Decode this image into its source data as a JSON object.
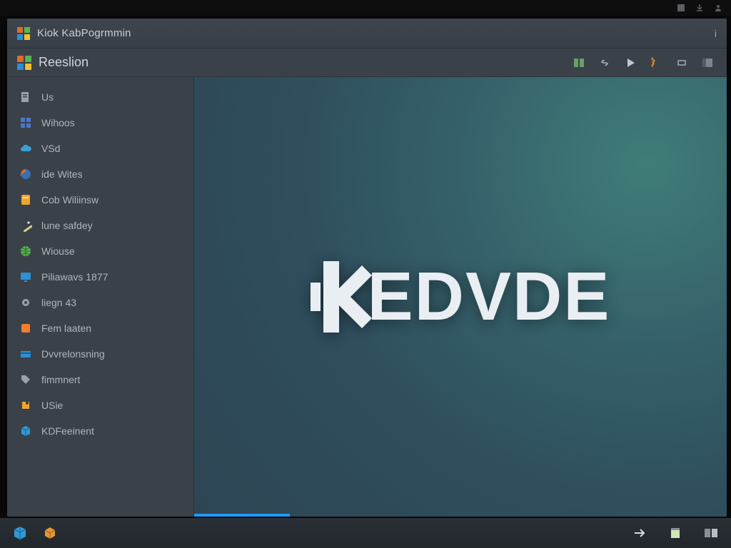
{
  "window": {
    "title": "Kiok KabPogrmmin",
    "title_right": "i",
    "section": "Reeslion"
  },
  "sidebar": {
    "items": [
      {
        "label": "Us",
        "icon": "document-icon",
        "tint": "#9aa1a7"
      },
      {
        "label": "Wihoos",
        "icon": "grid-icon",
        "tint": "#4a78c9"
      },
      {
        "label": "VSd",
        "icon": "cloud-icon",
        "tint": "#3aa0d8"
      },
      {
        "label": "ide Wites",
        "icon": "fox-icon",
        "tint": "#e06b2c"
      },
      {
        "label": "Cob Wiliinsw",
        "icon": "note-icon",
        "tint": "#f0a52e"
      },
      {
        "label": "lune safdey",
        "icon": "wand-icon",
        "tint": "#d9ce8a"
      },
      {
        "label": "Wiouse",
        "icon": "globe-icon",
        "tint": "#59b553"
      },
      {
        "label": "Piliawavs 1877",
        "icon": "monitor-icon",
        "tint": "#2e8fd6"
      },
      {
        "label": "liegn 43",
        "icon": "gear-icon",
        "tint": "#9aa1a7"
      },
      {
        "label": "Fem laaten",
        "icon": "square-icon",
        "tint": "#f07e2e"
      },
      {
        "label": "Dvvrelonsning",
        "icon": "card-icon",
        "tint": "#2e8fd6"
      },
      {
        "label": "fimmnert",
        "icon": "tag-icon",
        "tint": "#9aa1a7"
      },
      {
        "label": "USie",
        "icon": "puzzle-icon",
        "tint": "#f0a52e"
      },
      {
        "label": "KDFeeinent",
        "icon": "cube-icon",
        "tint": "#2e9bd6"
      }
    ]
  },
  "content": {
    "brand_text": "EDVDE"
  },
  "toolbar_icons": [
    "book-icon",
    "link-icon",
    "play-icon",
    "script-icon",
    "chip-icon",
    "panel-icon"
  ],
  "sys_icons": [
    "app-icon",
    "download-icon",
    "user-icon"
  ],
  "taskbar": {
    "left_icons": [
      "cube-launcher-icon",
      "box-icon"
    ],
    "tray_icons": [
      "arrow-right-icon",
      "note-tray-icon",
      "folder-tray-icon"
    ]
  }
}
